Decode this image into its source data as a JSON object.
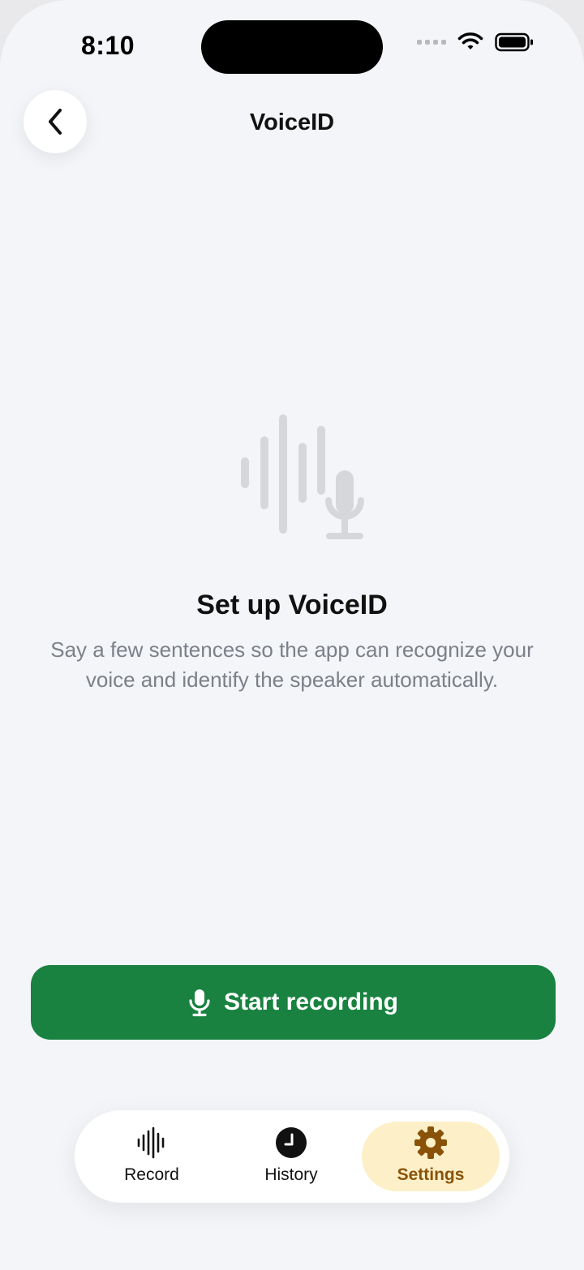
{
  "status_bar": {
    "time": "8:10"
  },
  "header": {
    "title": "VoiceID",
    "back_icon": "chevron-left-icon"
  },
  "hero": {
    "icon": "voice-waveform-microphone-icon",
    "title": "Set up VoiceID",
    "description": "Say a few sentences so the app can recognize your voice and identify the speaker automatically."
  },
  "primary_action": {
    "label": "Start recording",
    "icon": "microphone-icon",
    "color": "#198240"
  },
  "tab_bar": {
    "tabs": [
      {
        "label": "Record",
        "icon": "waveform-icon",
        "active": false
      },
      {
        "label": "History",
        "icon": "clock-icon",
        "active": false
      },
      {
        "label": "Settings",
        "icon": "gear-icon",
        "active": true
      }
    ],
    "active_background": "#fdf0c8",
    "active_color": "#8a5208"
  }
}
